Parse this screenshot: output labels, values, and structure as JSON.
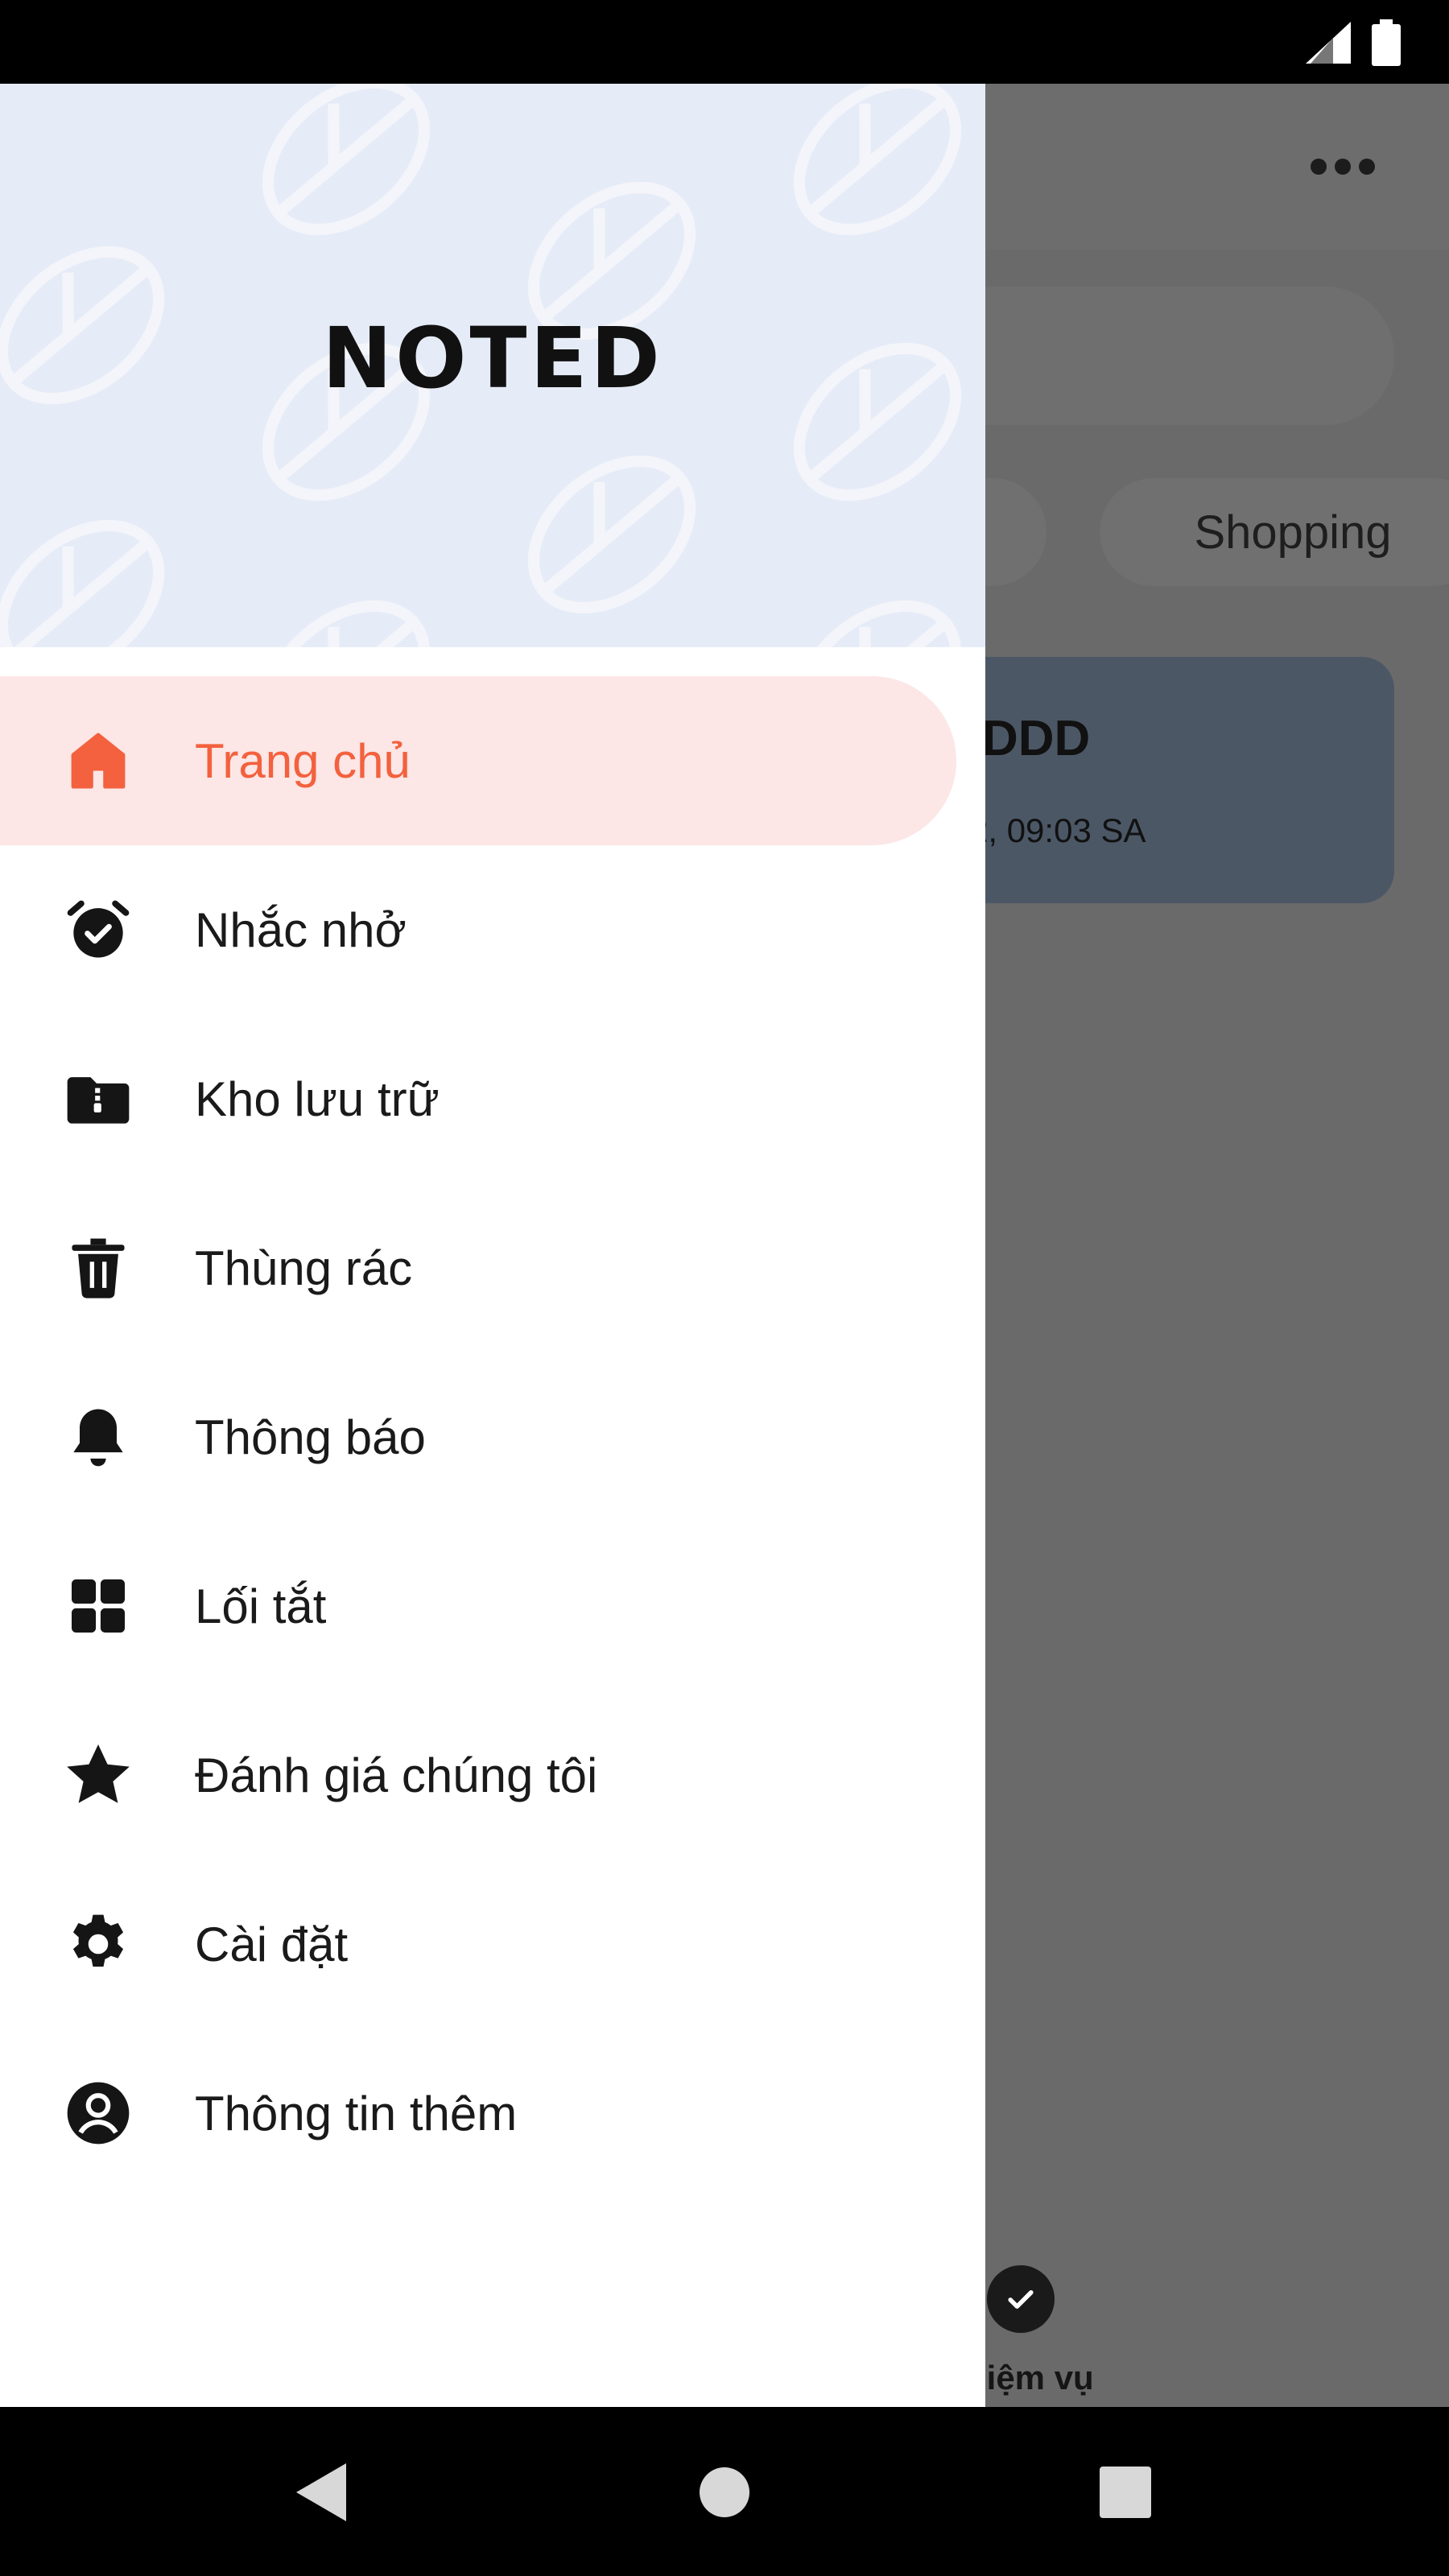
{
  "status_bar": {
    "icons": [
      "signal-icon",
      "battery-icon"
    ]
  },
  "background_app": {
    "chips": [
      "Shopping"
    ],
    "note_card": {
      "title_partial": "DDD",
      "date_partial": "2, 09:03 SA"
    },
    "bottom_tab_partial": "hiệm vụ",
    "icons": [
      "more-icon",
      "check-icon"
    ],
    "card_color": "#4c5766"
  },
  "drawer": {
    "logo": "NOTED",
    "header_color": "#e6ecf7",
    "active_color": "#f3613e",
    "active_bg": "#fce6e6",
    "items": [
      {
        "label": "Trang chủ",
        "icon": "home-icon",
        "active": true
      },
      {
        "label": "Nhắc nhở",
        "icon": "alarm-icon"
      },
      {
        "label": "Kho lưu trữ",
        "icon": "archive-folder-icon"
      },
      {
        "label": "Thùng rác",
        "icon": "trash-icon"
      },
      {
        "label": "Thông báo",
        "icon": "bell-icon"
      },
      {
        "label": "Lối tắt",
        "icon": "grid-icon"
      },
      {
        "label": "Đánh giá chúng tôi",
        "icon": "star-icon"
      },
      {
        "label": "Cài đặt",
        "icon": "gear-icon"
      },
      {
        "label": "Thông tin thêm",
        "icon": "account-circle-icon"
      }
    ]
  },
  "nav_bar": {
    "buttons": [
      "back-icon",
      "home-circle-icon",
      "recents-icon"
    ]
  }
}
